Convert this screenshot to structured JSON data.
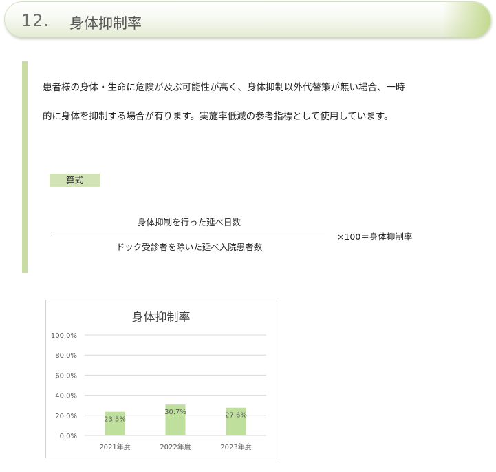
{
  "header": {
    "number": "12.",
    "title": "身体抑制率"
  },
  "description": {
    "line1": "患者様の身体・生命に危険が及ぶ可能性が高く、身体抑制以外代替策が無い場合、一時",
    "line2": "的に身体を抑制する場合が有ります。実施率低減の参考指標として使用しています。"
  },
  "formula": {
    "label": "算式",
    "numerator": "身体抑制を行った延べ日数",
    "denominator": "ドック受診者を除いた延べ入院患者数",
    "result": "×100＝身体抑制率"
  },
  "colors": {
    "bar": "#bfdf9c",
    "grid": "#d9d9d9",
    "axis_text": "#595959",
    "title_text": "#404040",
    "accent": "#c8dca4"
  },
  "chart_data": {
    "type": "bar",
    "title": "身体抑制率",
    "categories": [
      "2021年度",
      "2022年度",
      "2023年度"
    ],
    "values": [
      23.5,
      30.7,
      27.6
    ],
    "value_labels": [
      "23.5%",
      "30.7%",
      "27.6%"
    ],
    "ylim": [
      0,
      100
    ],
    "yticks": [
      "0.0%",
      "20.0%",
      "40.0%",
      "60.0%",
      "80.0%",
      "100.0%"
    ],
    "ytick_values": [
      0,
      20,
      40,
      60,
      80,
      100
    ],
    "grid": true,
    "legend": "none",
    "xlabel": "",
    "ylabel": ""
  }
}
